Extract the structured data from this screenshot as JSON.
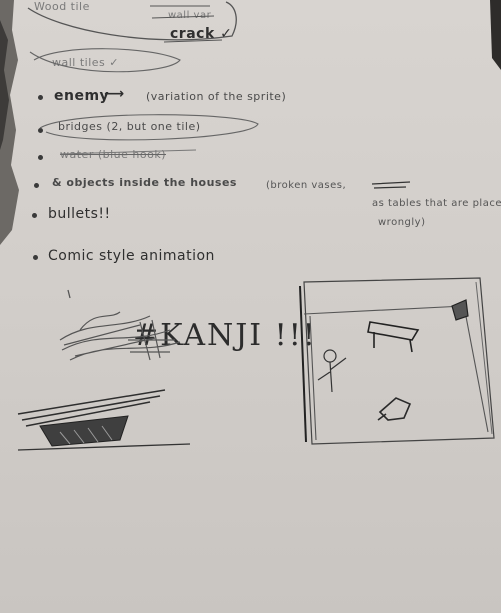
{
  "notes": {
    "wood_tile": "Wood tile",
    "wall_variation": "wall var",
    "crack": "crack ✓",
    "wall_tile": "wall tiles ✓",
    "enemy": "enemy",
    "enemy_arrow": "⟶",
    "enemy_note": "(variation of the sprite)",
    "bridges": "bridges (2, but one tile)",
    "water": "water (blue hook)",
    "objects": "& objects inside the houses",
    "objects_note": "(broken vases,",
    "objects_note_2": "as tables that are placed",
    "objects_note_3": "wrongly)",
    "bullets": "bullets!!",
    "comic": "Comic style animation",
    "kanji": "#KANJI !!!"
  }
}
